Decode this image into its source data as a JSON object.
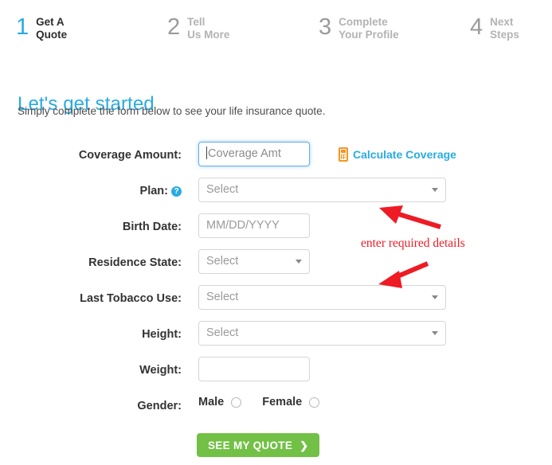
{
  "stepper": {
    "steps": [
      {
        "number": "1",
        "label": "Get A\nQuote",
        "state": "active"
      },
      {
        "number": "2",
        "label": "Tell\nUs More",
        "state": "idle"
      },
      {
        "number": "3",
        "label": "Complete\nYour Profile",
        "state": "idle"
      },
      {
        "number": "4",
        "label": "Next\nSteps",
        "state": "idle"
      }
    ],
    "active_color": "#0099d8",
    "idle_color": "#bfbfbf"
  },
  "header": {
    "title": "Let's get started",
    "subtitle": "Simply complete the form below to see your life insurance quote.",
    "title_color": "#29abe2"
  },
  "form": {
    "coverage": {
      "label": "Coverage Amount:",
      "placeholder": "Coverage Amt",
      "value": ""
    },
    "calculate_link": {
      "text": "Calculate Coverage",
      "icon": "calculator-icon",
      "icon_color": "#f7941e",
      "text_color": "#29abe2"
    },
    "plan": {
      "label": "Plan:",
      "help_icon": "question-mark-icon",
      "value": "Select"
    },
    "birth_date": {
      "label": "Birth Date:",
      "placeholder": "MM/DD/YYYY",
      "value": ""
    },
    "residence_state": {
      "label": "Residence State:",
      "value": "Select"
    },
    "last_tobacco_use": {
      "label": "Last Tobacco Use:",
      "value": "Select"
    },
    "height": {
      "label": "Height:",
      "value": "Select"
    },
    "weight": {
      "label": "Weight:",
      "placeholder": "",
      "value": ""
    },
    "gender": {
      "label": "Gender:",
      "options": [
        {
          "label": "Male",
          "selected": false
        },
        {
          "label": "Female",
          "selected": false
        }
      ]
    },
    "submit": {
      "label": "SEE MY QUOTE",
      "chevron": "chevron-right-icon",
      "color": "#72c045"
    }
  },
  "annotation": {
    "text": "enter required details",
    "color": "#ee1b24"
  }
}
